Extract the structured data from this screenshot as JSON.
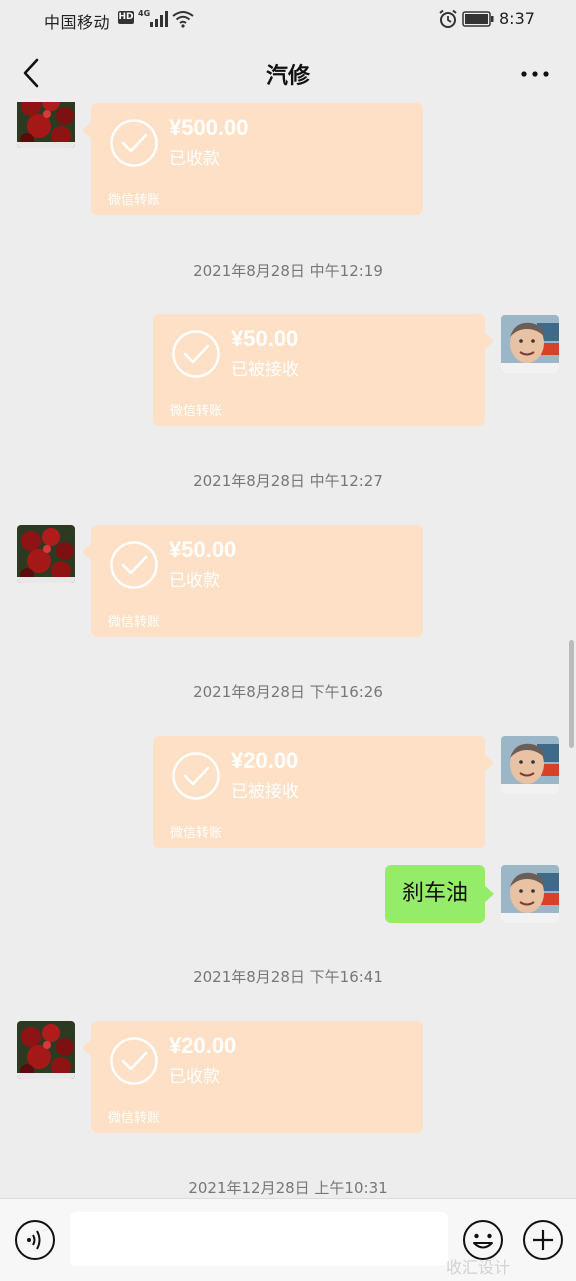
{
  "status_bar": {
    "carrier": "中国移动",
    "hd": "HD",
    "network": "4G",
    "time": "8:37"
  },
  "header": {
    "title": "汽修"
  },
  "messages": [
    {
      "kind": "transfer",
      "side": "received",
      "amount": "¥500.00",
      "status": "已收款",
      "footer": "微信转账"
    },
    {
      "kind": "time",
      "text": "2021年8月28日 中午12:19"
    },
    {
      "kind": "transfer",
      "side": "sent",
      "amount": "¥50.00",
      "status": "已被接收",
      "footer": "微信转账"
    },
    {
      "kind": "time",
      "text": "2021年8月28日 中午12:27"
    },
    {
      "kind": "transfer",
      "side": "received",
      "amount": "¥50.00",
      "status": "已收款",
      "footer": "微信转账"
    },
    {
      "kind": "time",
      "text": "2021年8月28日 下午16:26"
    },
    {
      "kind": "transfer",
      "side": "sent",
      "amount": "¥20.00",
      "status": "已被接收",
      "footer": "微信转账"
    },
    {
      "kind": "text",
      "side": "sent",
      "text": "刹车油"
    },
    {
      "kind": "time",
      "text": "2021年8月28日 下午16:41"
    },
    {
      "kind": "transfer",
      "side": "received",
      "amount": "¥20.00",
      "status": "已收款",
      "footer": "微信转账"
    },
    {
      "kind": "time",
      "text": "2021年12月28日 上午10:31"
    }
  ],
  "input_bar": {
    "placeholder": ""
  },
  "watermark": "收汇设计",
  "colors": {
    "transfer_bubble": "#fde0c5",
    "text_bubble_sent": "#95ec69",
    "background": "#ededed"
  }
}
